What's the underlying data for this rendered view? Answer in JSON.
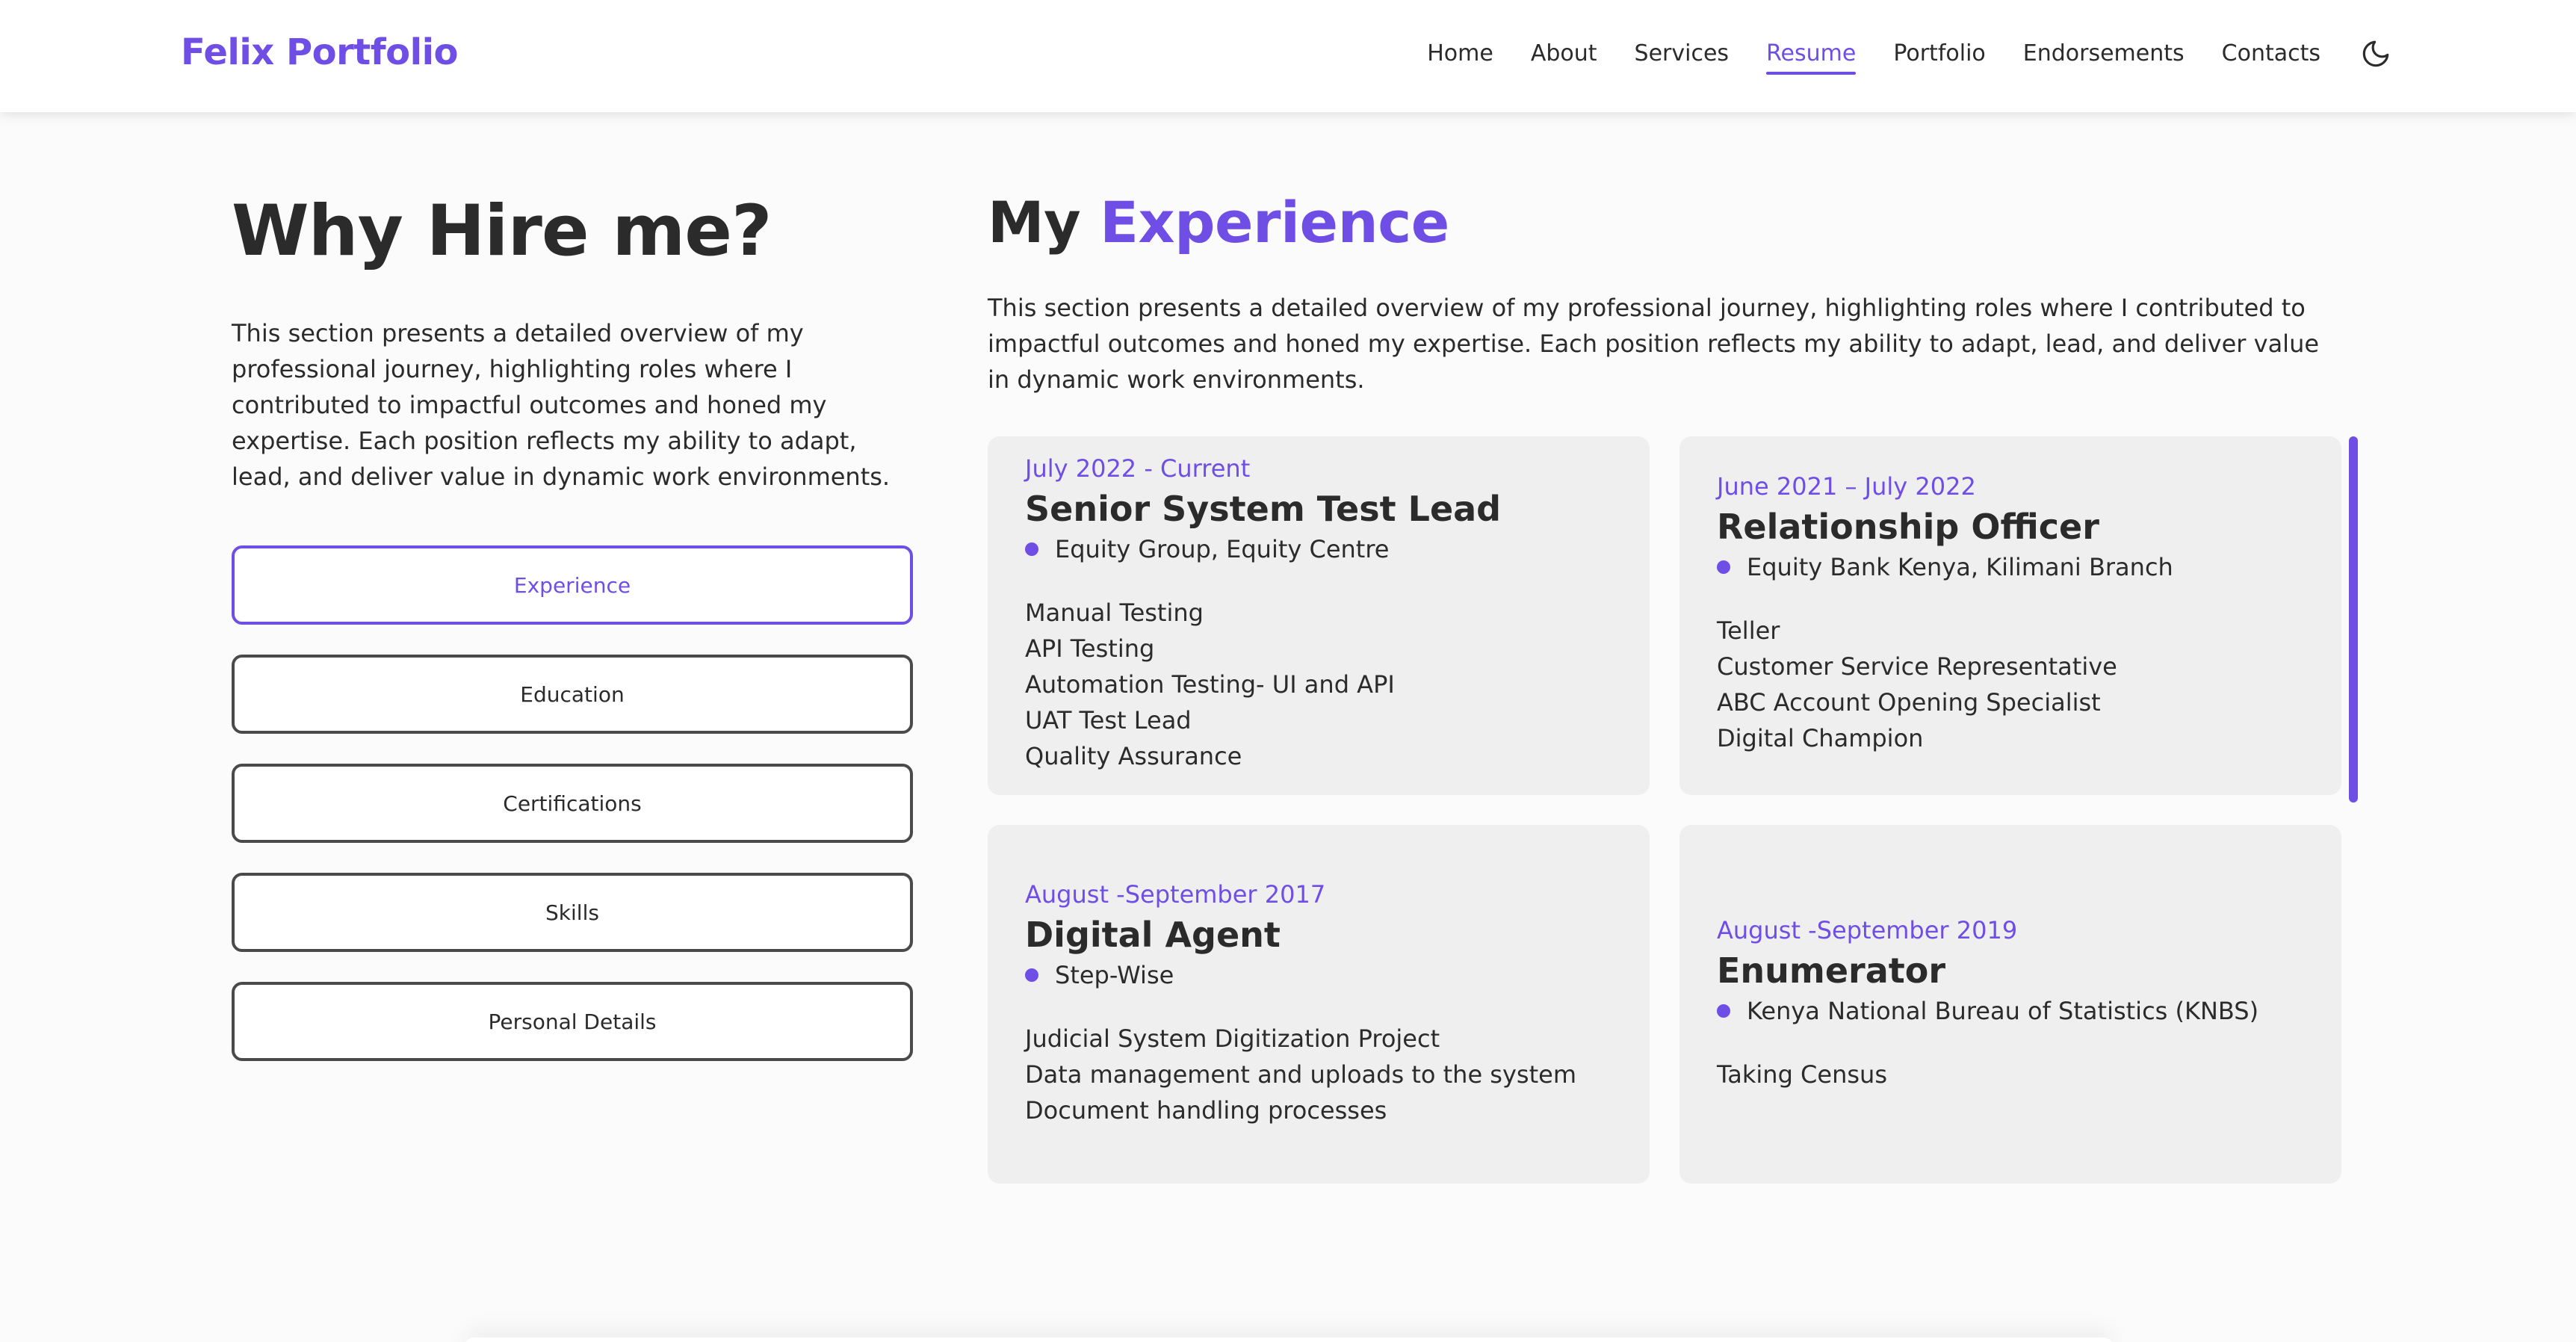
{
  "header": {
    "brand": "Felix Portfolio",
    "nav": [
      {
        "label": "Home",
        "active": false
      },
      {
        "label": "About",
        "active": false
      },
      {
        "label": "Services",
        "active": false
      },
      {
        "label": "Resume",
        "active": true
      },
      {
        "label": "Portfolio",
        "active": false
      },
      {
        "label": "Endorsements",
        "active": false
      },
      {
        "label": "Contacts",
        "active": false
      }
    ],
    "theme_toggle_icon": "moon-icon"
  },
  "left": {
    "title": "Why Hire me?",
    "description": "This section presents a detailed overview of my professional journey, highlighting roles where I contributed to impactful outcomes and honed my expertise. Each position reflects my ability to adapt, lead, and deliver value in dynamic work environments.",
    "tabs": [
      {
        "label": "Experience",
        "active": true
      },
      {
        "label": "Education",
        "active": false
      },
      {
        "label": "Certifications",
        "active": false
      },
      {
        "label": "Skills",
        "active": false
      },
      {
        "label": "Personal Details",
        "active": false
      }
    ]
  },
  "experience": {
    "title_prefix": "My",
    "title_accent": "Experience",
    "description": "This section presents a detailed overview of my professional journey, highlighting roles where I contributed to impactful outcomes and honed my expertise. Each position reflects my ability to adapt, lead, and deliver value in dynamic work environments.",
    "cards": [
      {
        "period": "July 2022 - Current",
        "role": "Senior System Test Lead",
        "org": "Equity Group, Equity Centre",
        "duties": [
          "Manual Testing",
          "API Testing",
          "Automation Testing- UI and API",
          "UAT Test Lead",
          "Quality Assurance"
        ]
      },
      {
        "period": "June 2021 – July 2022",
        "role": "Relationship Officer",
        "org": "Equity Bank Kenya, Kilimani Branch",
        "duties": [
          "Teller",
          "Customer Service Representative",
          "ABC Account Opening Specialist",
          "Digital Champion"
        ]
      },
      {
        "period": "August -September 2017",
        "role": "Digital Agent",
        "org": "Step-Wise",
        "duties": [
          "Judicial System Digitization Project",
          "Data management and uploads to the system",
          "Document handling processes"
        ]
      },
      {
        "period": "August -September 2019",
        "role": "Enumerator",
        "org": "Kenya National Bureau of Statistics (KNBS)",
        "duties": [
          "Taking Census"
        ]
      }
    ]
  },
  "colors": {
    "accent": "#6f4ee6",
    "text": "#2b2b2b",
    "card_bg": "#efefef",
    "page_bg": "#fbfbfb"
  }
}
